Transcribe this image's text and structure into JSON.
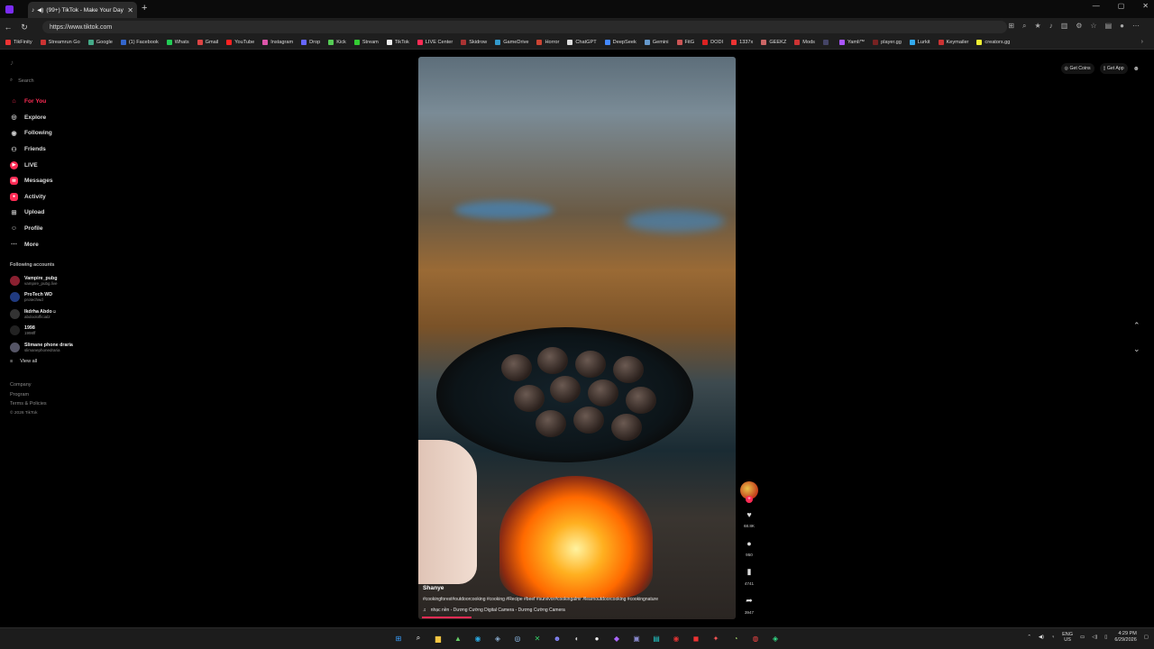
{
  "browser": {
    "tab_title": "(99+) TikTok - Make Your Day",
    "url": "https://www.tiktok.com",
    "bookmarks": [
      "TikFinity",
      "Streamrun Go",
      "Google",
      "(1) Facebook",
      "Whats",
      "Gmail",
      "YouTube",
      "Instagram",
      "Drop",
      "Kick",
      "Stream",
      "TikTok",
      "LIVE Center",
      "Skidrow",
      "GameDrive",
      "Horror",
      "ChatGPT",
      "DeepSeek",
      "Gemini",
      "FitG",
      "DODI",
      "1337x",
      "GEEKZ",
      "Mods",
      "",
      "Yamli™",
      "player.gg",
      "Lurkit",
      "Keymailer",
      "creators.gg"
    ],
    "bookmark_colors": [
      "#e33",
      "#c33",
      "#4a8",
      "#36c",
      "#2c5",
      "#d44",
      "#f22",
      "#d5a",
      "#66f",
      "#5c5",
      "#3c3",
      "#eee",
      "#fe2c55",
      "#a33",
      "#39c",
      "#c43",
      "#ddd",
      "#48f",
      "#69c",
      "#c55",
      "#d22",
      "#e33",
      "#c66",
      "#c33",
      "#446",
      "#a5f",
      "#722",
      "#3ae",
      "#c33",
      "#ee3"
    ]
  },
  "sidebar": {
    "search_placeholder": "Search",
    "nav": [
      {
        "label": "For You",
        "icon": "home-icon",
        "glyph": "⌂",
        "active": true
      },
      {
        "label": "Explore",
        "icon": "compass-icon",
        "glyph": "◎"
      },
      {
        "label": "Following",
        "icon": "following-icon",
        "glyph": "◉"
      },
      {
        "label": "Friends",
        "icon": "friends-icon",
        "glyph": "⚇"
      },
      {
        "label": "LIVE",
        "icon": "live-icon",
        "glyph": "▶"
      },
      {
        "label": "Messages",
        "icon": "messages-icon",
        "glyph": "✉"
      },
      {
        "label": "Activity",
        "icon": "activity-icon",
        "glyph": "●"
      },
      {
        "label": "Upload",
        "icon": "upload-icon",
        "glyph": "⊞"
      },
      {
        "label": "Profile",
        "icon": "profile-icon",
        "glyph": "☺"
      },
      {
        "label": "More",
        "icon": "more-icon",
        "glyph": "⋯"
      }
    ],
    "following_title": "Following accounts",
    "following": [
      {
        "name": "Vampire_pubg",
        "handle": "vampire_pubg.live",
        "color": "#8a2030"
      },
      {
        "name": "ProTech WD",
        "handle": "protechwd",
        "color": "#203a80"
      },
      {
        "name": "Ikdrha Abdo☺",
        "handle": "abdoolofficial2",
        "color": "#333"
      },
      {
        "name": "1998",
        "handle": "1998ff",
        "color": "#222"
      },
      {
        "name": "Slimane phone draria",
        "handle": "slimanephonedraria",
        "color": "#556"
      }
    ],
    "view_all": "View all",
    "footer": [
      "Company",
      "Program",
      "Terms & Policies",
      "© 2026 TikTok"
    ]
  },
  "video": {
    "author": "Shanye",
    "tags": "#cookingforest#outdoorcooking #cooking #Recipe #beef #survivor#cookingalmr #learnoutdoorcooking #cookingnature",
    "music": "nhạc nền - Dương Cường Digital Camera - Dương Cường Camera",
    "actions": [
      {
        "name": "like",
        "icon": "heart-icon",
        "glyph": "♥",
        "count": "68.8K"
      },
      {
        "name": "comment",
        "icon": "comment-icon",
        "glyph": "●",
        "count": "950"
      },
      {
        "name": "save",
        "icon": "bookmark-icon",
        "glyph": "▮",
        "count": "4741"
      },
      {
        "name": "share",
        "icon": "share-icon",
        "glyph": "➦",
        "count": "3947"
      }
    ]
  },
  "topbar": {
    "get_coins": "Get Coins",
    "get_app": "Get App"
  },
  "taskbar": {
    "lang": "ENG",
    "region": "US",
    "time": "4:29 PM",
    "date": "6/29/2026"
  }
}
